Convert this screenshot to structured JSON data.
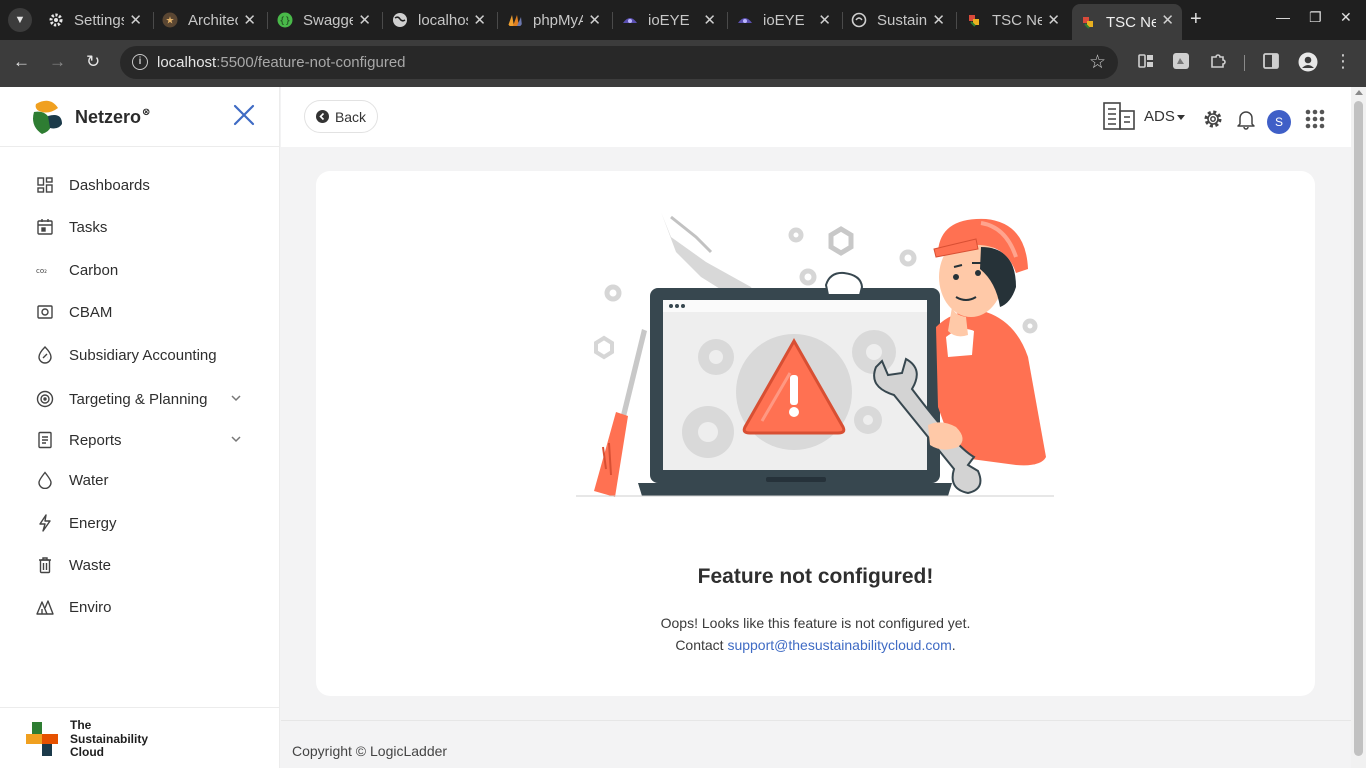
{
  "browser": {
    "tabs": [
      {
        "title": "Settings",
        "favicon": "gear-icon",
        "color": "#e0e0e0"
      },
      {
        "title": "Architect",
        "favicon": "star-icon",
        "color": "#8a6d3b"
      },
      {
        "title": "Swagger",
        "favicon": "swagger-icon",
        "color": "#49b949"
      },
      {
        "title": "localhost",
        "favicon": "globe-icon",
        "color": "#cfcfcf"
      },
      {
        "title": "phpMyAdmin",
        "favicon": "phpmyadmin-icon",
        "color": "#f0a030"
      },
      {
        "title": "ioEYE",
        "favicon": "ioeye-icon",
        "color": "#6a6ac8"
      },
      {
        "title": "ioEYE",
        "favicon": "ioeye-icon",
        "color": "#6a6ac8"
      },
      {
        "title": "Sustain",
        "favicon": "sustain-icon",
        "color": "#d0d0d0"
      },
      {
        "title": "TSC Netzero",
        "favicon": "tsc-icon",
        "color": "#d94a3a"
      },
      {
        "title": "TSC Netzero",
        "favicon": "tsc-icon",
        "color": "#d94a3a"
      }
    ],
    "active_tab": 9,
    "url_host": "localhost",
    "url_rest": ":5500/feature-not-configured"
  },
  "sidebar": {
    "brand_name": "Netzero",
    "items": [
      {
        "label": "Dashboards",
        "icon": "dashboard-grid-icon",
        "has_children": false
      },
      {
        "label": "Tasks",
        "icon": "calendar-icon",
        "has_children": false
      },
      {
        "label": "Carbon",
        "icon": "co2-icon",
        "has_children": false
      },
      {
        "label": "CBAM",
        "icon": "cbam-icon",
        "has_children": false
      },
      {
        "label": "Subsidiary Accounting",
        "icon": "subsidiary-icon",
        "has_children": false
      },
      {
        "label": "Targeting & Planning",
        "icon": "target-icon",
        "has_children": true
      },
      {
        "label": "Reports",
        "icon": "report-icon",
        "has_children": true
      },
      {
        "label": "Water",
        "icon": "water-drop-icon",
        "has_children": false
      },
      {
        "label": "Energy",
        "icon": "lightning-icon",
        "has_children": false
      },
      {
        "label": "Waste",
        "icon": "trash-icon",
        "has_children": false
      },
      {
        "label": "Enviro",
        "icon": "trees-icon",
        "has_children": false
      }
    ],
    "footer_brand": [
      "The",
      "Sustainability",
      "Cloud"
    ]
  },
  "topbar": {
    "back_label": "Back",
    "org_name": "ADS",
    "avatar_initial": "S"
  },
  "main": {
    "title": "Feature not configured!",
    "line1": "Oops! Looks like this feature is not configured yet.",
    "contact_prefix": "Contact ",
    "contact_email": "support@thesustainabilitycloud.com",
    "contact_suffix": "."
  },
  "footer": {
    "copyright": "Copyright © LogicLadder"
  },
  "colors": {
    "accent": "#3f6bc4",
    "illustration_orange": "#ff7152",
    "laptop_dark": "#37474f"
  }
}
